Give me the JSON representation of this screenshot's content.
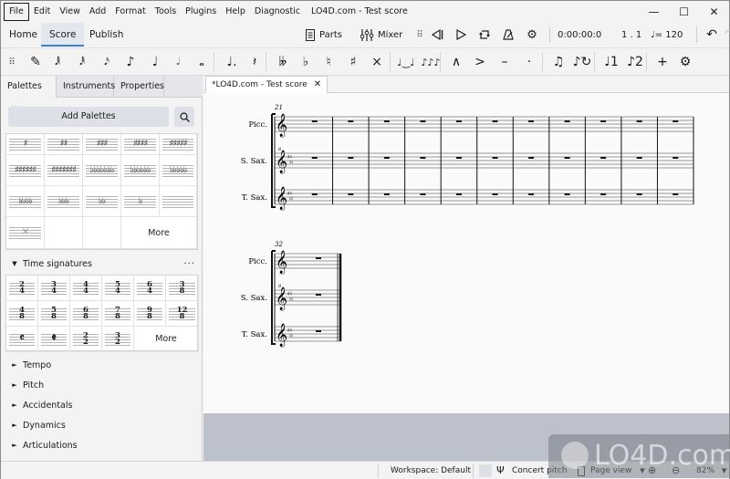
{
  "window": {
    "title": "LO4D.com - Test score",
    "controls": [
      "minimize",
      "maximize",
      "close"
    ]
  },
  "menu": [
    {
      "label": "File",
      "accel": "F"
    },
    {
      "label": "Edit",
      "accel": "E"
    },
    {
      "label": "View",
      "accel": "V"
    },
    {
      "label": "Add",
      "accel": "A"
    },
    {
      "label": "Format",
      "accel": "o"
    },
    {
      "label": "Tools",
      "accel": "T"
    },
    {
      "label": "Plugins",
      "accel": "P"
    },
    {
      "label": "Help",
      "accel": "H"
    },
    {
      "label": "Diagnostic",
      "accel": "D"
    }
  ],
  "workspace_tabs": [
    {
      "label": "Home",
      "selected": false
    },
    {
      "label": "Score",
      "selected": true
    },
    {
      "label": "Publish",
      "selected": false
    }
  ],
  "playback": {
    "parts_label": "Parts",
    "mixer_label": "Mixer",
    "time": "0:00:00:0",
    "position": "1 . 1",
    "tempo": "♩= 120"
  },
  "note_toolbar": {
    "items": [
      {
        "name": "drag-handle",
        "glyph": "⠿"
      },
      {
        "name": "note-input-pencil",
        "glyph": "✎"
      },
      {
        "name": "64th-note",
        "glyph": "𝅘𝅥𝅲"
      },
      {
        "name": "32nd-note",
        "glyph": "𝅘𝅥𝅱"
      },
      {
        "name": "16th-note",
        "glyph": "𝅘𝅥𝅯"
      },
      {
        "name": "eighth-note",
        "glyph": "♪"
      },
      {
        "name": "quarter-note",
        "glyph": "♩"
      },
      {
        "name": "half-note",
        "glyph": "𝅗𝅥"
      },
      {
        "name": "whole-note",
        "glyph": "𝅝"
      },
      {
        "name": "augmentation-dot",
        "glyph": "♩."
      },
      {
        "name": "rest",
        "glyph": "𝄽"
      },
      {
        "name": "double-flat",
        "glyph": "𝄫"
      },
      {
        "name": "flat",
        "glyph": "♭"
      },
      {
        "name": "natural",
        "glyph": "♮"
      },
      {
        "name": "sharp",
        "glyph": "♯"
      },
      {
        "name": "double-sharp",
        "glyph": "×"
      },
      {
        "name": "tie",
        "glyph": "♩‿♩"
      },
      {
        "name": "slur",
        "glyph": "♪♪♪"
      },
      {
        "name": "marcato",
        "glyph": "∧"
      },
      {
        "name": "accent",
        "glyph": ">"
      },
      {
        "name": "tenuto",
        "glyph": "–"
      },
      {
        "name": "staccato",
        "glyph": "·"
      },
      {
        "name": "tuplet",
        "glyph": "♫"
      },
      {
        "name": "flip-direction",
        "glyph": "♪↻"
      },
      {
        "name": "voice-1",
        "glyph": "♩1"
      },
      {
        "name": "voice-2",
        "glyph": "♪2"
      },
      {
        "name": "add",
        "glyph": "+"
      },
      {
        "name": "customize-toolbar",
        "glyph": "⚙"
      }
    ]
  },
  "left_panel": {
    "tabs": [
      {
        "label": "Palettes",
        "selected": true,
        "menu": "···"
      },
      {
        "label": "Instruments",
        "selected": false
      },
      {
        "label": "Properties",
        "selected": false
      }
    ],
    "add_palettes_label": "Add Palettes",
    "key_signatures": {
      "rows": [
        [
          "♯",
          "♯♯",
          "♯♯♯",
          "♯♯♯♯",
          "♯♯♯♯♯"
        ],
        [
          "♯♯♯♯♯♯",
          "♯♯♯♯♯♯♯",
          "♭♭♭♭♭♭♭",
          "♭♭♭♭♭♭",
          "♭♭♭♭♭"
        ],
        [
          "♭♭♭♭",
          "♭♭♭",
          "♭♭",
          "♭",
          ""
        ],
        [
          "✕",
          "",
          "",
          "More"
        ]
      ]
    },
    "time_signatures": {
      "title": "Time signatures",
      "menu": "···",
      "cells": [
        {
          "top": "2",
          "bottom": "4"
        },
        {
          "top": "3",
          "bottom": "4"
        },
        {
          "top": "4",
          "bottom": "4"
        },
        {
          "top": "5",
          "bottom": "4"
        },
        {
          "top": "6",
          "bottom": "4"
        },
        {
          "top": "3",
          "bottom": "8"
        },
        {
          "top": "4",
          "bottom": "8"
        },
        {
          "top": "5",
          "bottom": "8"
        },
        {
          "top": "6",
          "bottom": "8"
        },
        {
          "top": "7",
          "bottom": "8"
        },
        {
          "top": "9",
          "bottom": "8"
        },
        {
          "top": "12",
          "bottom": "8"
        },
        {
          "symbol": "𝄴"
        },
        {
          "symbol": "𝄵"
        },
        {
          "top": "2",
          "bottom": "2"
        },
        {
          "top": "3",
          "bottom": "2"
        }
      ],
      "more_label": "More"
    },
    "collapsed_palettes": [
      "Tempo",
      "Pitch",
      "Accidentals",
      "Dynamics",
      "Articulations"
    ]
  },
  "document": {
    "tab_label": "*LO4D.com - Test score",
    "systems": [
      {
        "measure_number": "21",
        "instruments": [
          "Picc.",
          "S. Sax.",
          "T. Sax."
        ],
        "measures": 11
      },
      {
        "measure_number": "32",
        "instruments": [
          "Picc.",
          "S. Sax.",
          "T. Sax."
        ],
        "measures": 1,
        "final": true
      }
    ]
  },
  "status_bar": {
    "workspace": "Workspace: Default",
    "concert_pitch": "Concert pitch",
    "view_mode": "Page view",
    "zoom": "82%"
  },
  "watermark": "LO4D.com"
}
